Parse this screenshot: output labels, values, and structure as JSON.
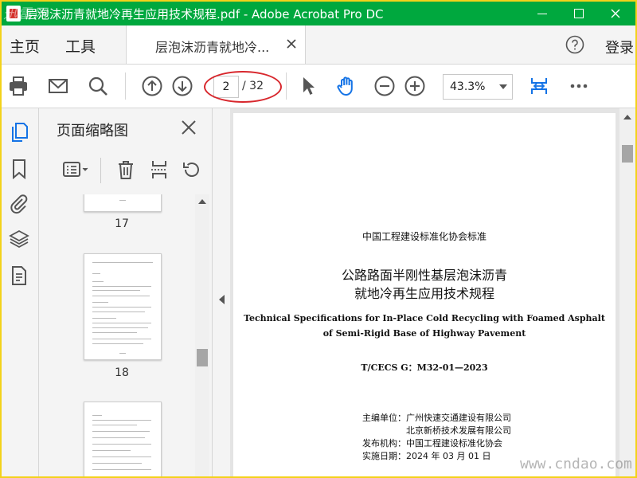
{
  "window": {
    "title": "层泡沫沥青就地冷再生应用技术规程.pdf - Adobe Acrobat Pro DC",
    "watermark_top": "迅雷网"
  },
  "menu": {
    "home": "主页",
    "tools": "工具",
    "doc_tab": "层泡沫沥青就地冷...",
    "login": "登录"
  },
  "toolbar": {
    "current_page": "2",
    "total_pages": "/ 32",
    "zoom": "43.3%"
  },
  "thumbnails": {
    "title": "页面缩略图",
    "labels": [
      "17",
      "18"
    ]
  },
  "document": {
    "org": "中国工程建设标准化协会标准",
    "title_cn_1": "公路路面半刚性基层泡沫沥青",
    "title_cn_2": "就地冷再生应用技术规程",
    "title_en_1": "Technical Specifications for In-Place Cold Recycling with Foamed Asphalt",
    "title_en_2": "of Semi-Rigid Base of Highway Pavement",
    "code": "T/CECS G：M32-01—2023",
    "info": [
      "主编单位：广州快速交通建设有限公司",
      "　　　　　北京新桥技术发展有限公司",
      "发布机构：中国工程建设标准化协会",
      "实施日期：2024 年 03 月 01 日"
    ]
  },
  "watermark_bottom": "www.cndao.com",
  "colors": {
    "titlebar": "#00a83e",
    "accent_blue": "#1473e6",
    "annotation_red": "#d8272d"
  }
}
